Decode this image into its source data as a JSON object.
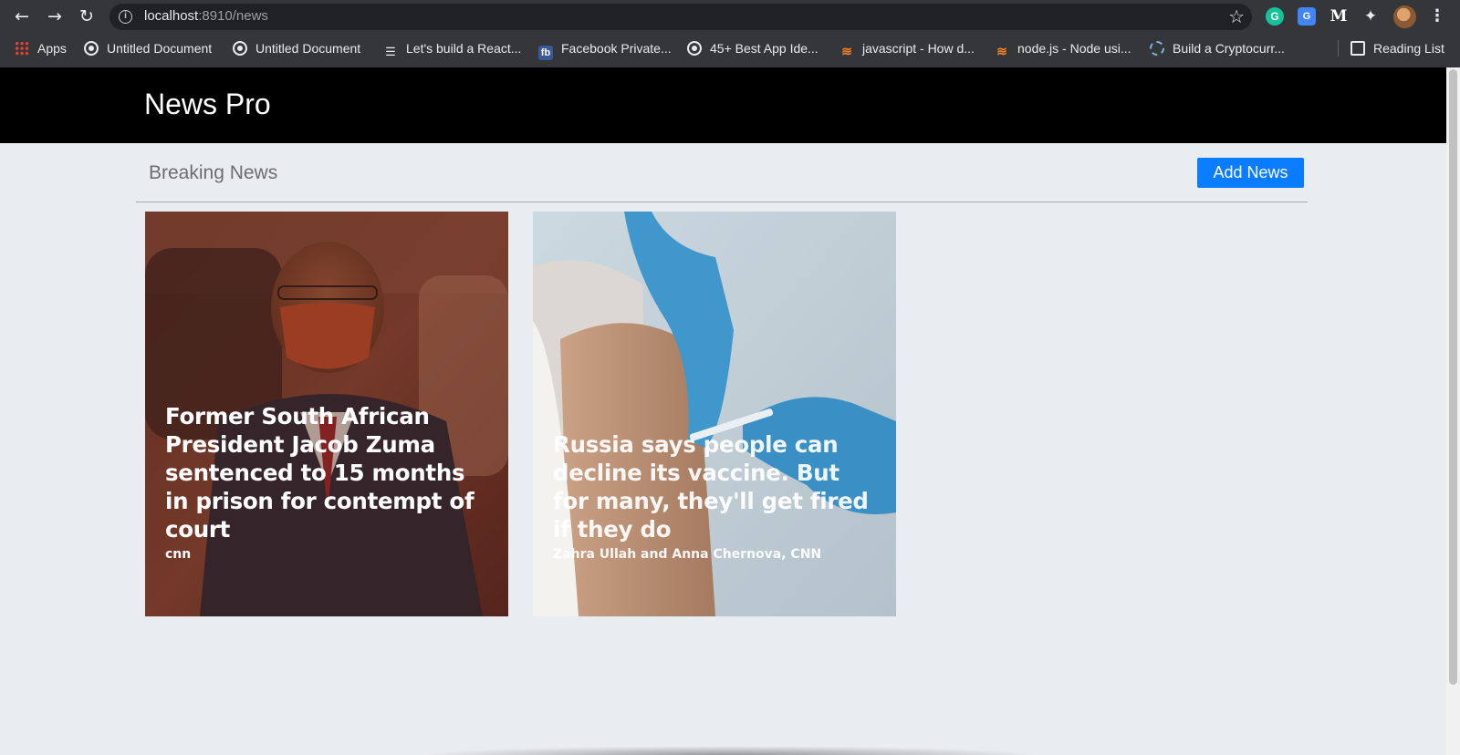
{
  "browser": {
    "url_host": "localhost",
    "url_rest": ":8910/news",
    "bookmarks": [
      {
        "label": "Apps",
        "icon": "apps-grid-icon"
      },
      {
        "label": "Untitled Document",
        "icon": "globe-icon"
      },
      {
        "label": "Untitled Document",
        "icon": "globe-icon"
      },
      {
        "label": "Let's build a React...",
        "icon": "list-icon"
      },
      {
        "label": "Facebook Private...",
        "icon": "fb-icon"
      },
      {
        "label": "45+ Best App Ide...",
        "icon": "globe-icon"
      },
      {
        "label": "javascript - How d...",
        "icon": "stackoverflow-icon"
      },
      {
        "label": "node.js - Node usi...",
        "icon": "stackoverflow-icon"
      },
      {
        "label": "Build a Cryptocurr...",
        "icon": "crypto-icon"
      }
    ],
    "reading_list": "Reading List",
    "extensions": {
      "grammarly": "G",
      "translate": "G",
      "medium": "M"
    }
  },
  "site": {
    "title": "News Pro"
  },
  "section": {
    "title": "Breaking News",
    "add_button": "Add News"
  },
  "cards": [
    {
      "headline": "Former South African President Jacob Zuma sentenced to 15 months in prison for contempt of court",
      "source": "cnn"
    },
    {
      "headline": "Russia says people can decline its vaccine. But for many, they'll get fired if they do",
      "source": "Zahra Ullah and Anna Chernova, CNN"
    }
  ],
  "colors": {
    "header_bg": "#000000",
    "page_bg": "#e9ecf1",
    "button": "#0a7cff"
  }
}
